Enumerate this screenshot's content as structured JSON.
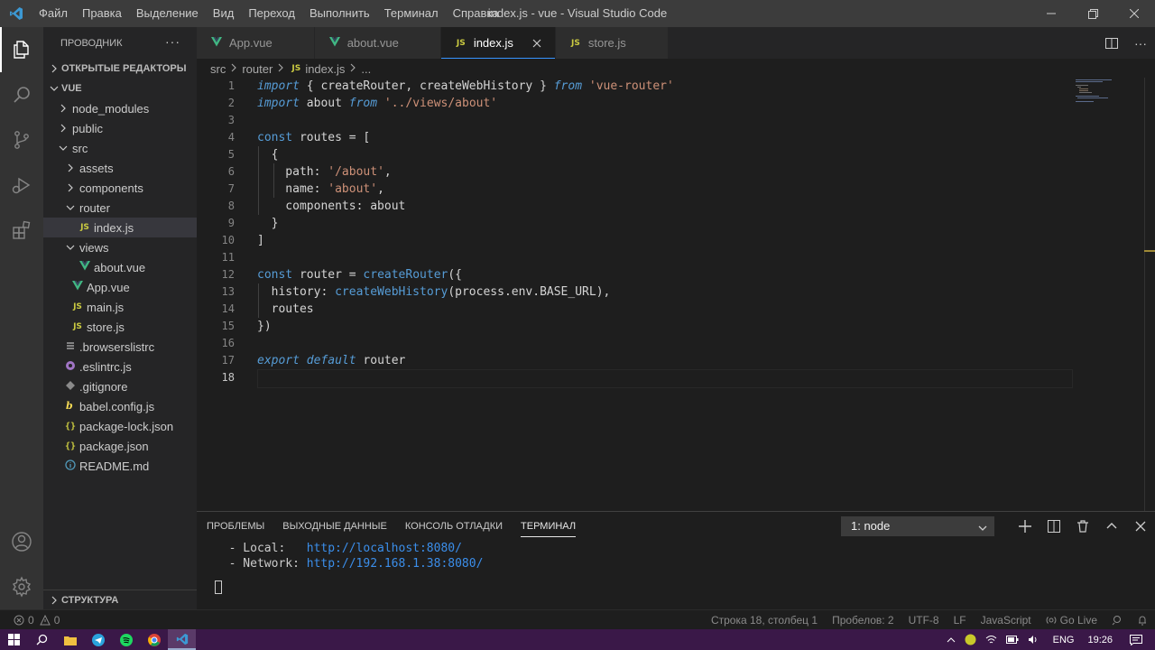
{
  "window": {
    "title": "index.js - vue - Visual Studio Code",
    "menu": [
      "Файл",
      "Правка",
      "Выделение",
      "Вид",
      "Переход",
      "Выполнить",
      "Терминал",
      "Справка"
    ]
  },
  "sidebar": {
    "header": "ПРОВОДНИК",
    "more": "···",
    "open_editors": "ОТКРЫТЫЕ РЕДАКТОРЫ",
    "root": "VUE",
    "tree": [
      {
        "label": "node_modules",
        "type": "folder",
        "depth": 1,
        "expanded": false
      },
      {
        "label": "public",
        "type": "folder",
        "depth": 1,
        "expanded": false
      },
      {
        "label": "src",
        "type": "folder",
        "depth": 1,
        "expanded": true
      },
      {
        "label": "assets",
        "type": "folder",
        "depth": 2,
        "expanded": false
      },
      {
        "label": "components",
        "type": "folder",
        "depth": 2,
        "expanded": false
      },
      {
        "label": "router",
        "type": "folder",
        "depth": 2,
        "expanded": true
      },
      {
        "label": "index.js",
        "type": "js",
        "depth": 3,
        "selected": true
      },
      {
        "label": "views",
        "type": "folder",
        "depth": 2,
        "expanded": true
      },
      {
        "label": "about.vue",
        "type": "vue",
        "depth": 3
      },
      {
        "label": "App.vue",
        "type": "vue",
        "depth": 2
      },
      {
        "label": "main.js",
        "type": "js",
        "depth": 2
      },
      {
        "label": "store.js",
        "type": "js",
        "depth": 2
      },
      {
        "label": ".browserslistrc",
        "type": "lines",
        "depth": 1
      },
      {
        "label": ".eslintrc.js",
        "type": "eslint",
        "depth": 1
      },
      {
        "label": ".gitignore",
        "type": "git",
        "depth": 1
      },
      {
        "label": "babel.config.js",
        "type": "babel",
        "depth": 1
      },
      {
        "label": "package-lock.json",
        "type": "json",
        "depth": 1
      },
      {
        "label": "package.json",
        "type": "json",
        "depth": 1
      },
      {
        "label": "README.md",
        "type": "info",
        "depth": 1
      }
    ],
    "structure": "СТРУКТУРА"
  },
  "tabs": [
    {
      "label": "App.vue",
      "type": "vue",
      "active": false
    },
    {
      "label": "about.vue",
      "type": "vue",
      "active": false
    },
    {
      "label": "index.js",
      "type": "js",
      "active": true
    },
    {
      "label": "store.js",
      "type": "js",
      "active": false
    }
  ],
  "js_badge": "JS",
  "breadcrumb": [
    "src",
    "router",
    "index.js",
    "..."
  ],
  "code_lines": [
    [
      [
        "kw",
        "import"
      ],
      [
        "p",
        " { createRouter, createWebHistory } "
      ],
      [
        "kw",
        "from"
      ],
      [
        "p",
        " "
      ],
      [
        "str",
        "'vue-router'"
      ]
    ],
    [
      [
        "kw",
        "import"
      ],
      [
        "p",
        " about "
      ],
      [
        "kw",
        "from"
      ],
      [
        "p",
        " "
      ],
      [
        "str",
        "'../views/about'"
      ]
    ],
    [],
    [
      [
        "kwc",
        "const"
      ],
      [
        "p",
        " routes = ["
      ]
    ],
    [
      [
        "p",
        "  {"
      ]
    ],
    [
      [
        "p",
        "    path: "
      ],
      [
        "str",
        "'/about'"
      ],
      [
        "p",
        ","
      ]
    ],
    [
      [
        "p",
        "    name: "
      ],
      [
        "str",
        "'about'"
      ],
      [
        "p",
        ","
      ]
    ],
    [
      [
        "p",
        "    components: about"
      ]
    ],
    [
      [
        "p",
        "  }"
      ]
    ],
    [
      [
        "p",
        "]"
      ]
    ],
    [],
    [
      [
        "kwc",
        "const"
      ],
      [
        "p",
        " router = "
      ],
      [
        "fn",
        "createRouter"
      ],
      [
        "p",
        "({"
      ]
    ],
    [
      [
        "p",
        "  history: "
      ],
      [
        "fn",
        "createWebHistory"
      ],
      [
        "p",
        "(process.env.BASE_URL),"
      ]
    ],
    [
      [
        "p",
        "  routes"
      ]
    ],
    [
      [
        "p",
        "})"
      ]
    ],
    [],
    [
      [
        "kw",
        "export"
      ],
      [
        "p",
        " "
      ],
      [
        "kw",
        "default"
      ],
      [
        "p",
        " router"
      ]
    ],
    []
  ],
  "current_line": 18,
  "panel": {
    "tabs": [
      "ПРОБЛЕМЫ",
      "ВЫХОДНЫЕ ДАННЫЕ",
      "КОНСОЛЬ ОТЛАДКИ",
      "ТЕРМИНАЛ"
    ],
    "active_tab": 3,
    "terminal_select": "1: node",
    "terminal_lines": [
      {
        "label": "  - Local:   ",
        "url": "http://localhost:8080/"
      },
      {
        "label": "  - Network: ",
        "url": "http://192.168.1.38:8080/"
      }
    ]
  },
  "status": {
    "errors": "0",
    "warnings": "0",
    "position": "Строка 18, столбец 1",
    "spaces": "Пробелов: 2",
    "encoding": "UTF-8",
    "eol": "LF",
    "language": "JavaScript",
    "golive": "Go Live"
  },
  "taskbar": {
    "lang": "ENG",
    "time": "19:26"
  },
  "colors": {
    "accent": "#3794ff",
    "activitybar": "#333333",
    "sidebar": "#252526",
    "editor": "#1e1e1e",
    "taskbar": "#3a1848",
    "keyword": "#569cd6",
    "string": "#ce9178"
  }
}
